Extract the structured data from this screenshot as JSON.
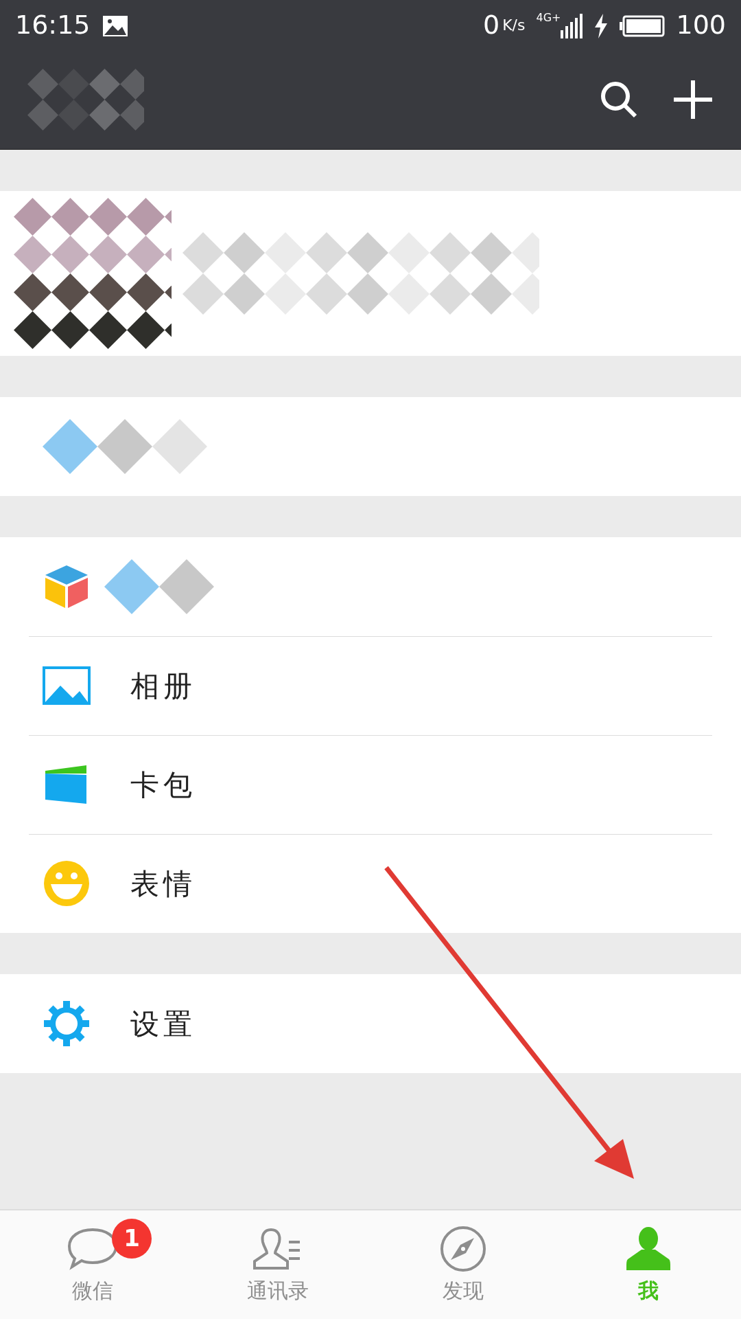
{
  "status_bar": {
    "time": "16:15",
    "net_speed": "0",
    "speed_unit": "K/s",
    "network": "4G+",
    "battery": "100"
  },
  "header": {
    "kind": "redacted"
  },
  "sections": [
    [
      {
        "kind": "redacted_profile"
      }
    ],
    [
      {
        "kind": "redacted_item"
      }
    ],
    [
      {
        "kind": "redacted_item"
      },
      {
        "kind": "item",
        "label": "相册"
      },
      {
        "kind": "item",
        "label": "卡包"
      },
      {
        "kind": "item",
        "label": "表情"
      }
    ],
    [
      {
        "kind": "item",
        "label": "设置"
      }
    ]
  ],
  "tabs": [
    {
      "label": "微信",
      "badge": "1",
      "selected": false
    },
    {
      "label": "通讯录",
      "selected": false
    },
    {
      "label": "发现",
      "selected": false
    },
    {
      "label": "我",
      "selected": true
    }
  ],
  "annotations": [
    {
      "kind": "arrow"
    }
  ]
}
